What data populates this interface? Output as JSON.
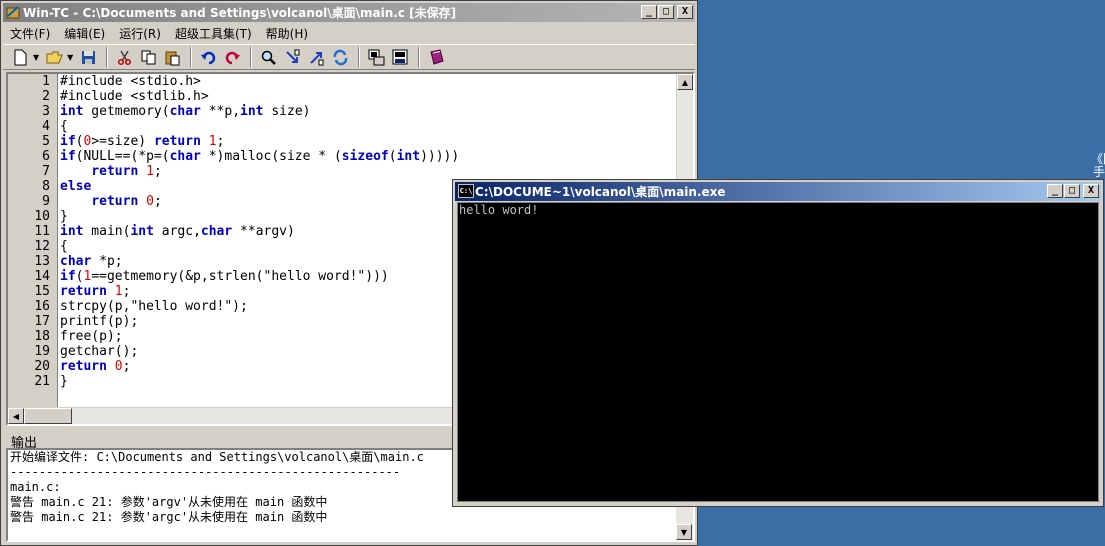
{
  "ide": {
    "title": "Win-TC - C:\\Documents and Settings\\volcanol\\桌面\\main.c [未保存]",
    "minimize": "_",
    "maximize": "□",
    "close": "X",
    "menu": [
      "文件(F)",
      "编辑(E)",
      "运行(R)",
      "超级工具集(T)",
      "帮助(H)"
    ]
  },
  "toolbar_icons": [
    "new-file-icon",
    "open-folder-icon",
    "save-icon",
    "cut-icon",
    "copy-icon",
    "paste-icon",
    "undo-icon",
    "redo-icon",
    "find-icon",
    "find-next-icon",
    "find-prev-icon",
    "replace-icon",
    "compile-icon",
    "run-icon",
    "help-book-icon"
  ],
  "editor": {
    "line_numbers": [
      "1",
      "2",
      "3",
      "4",
      "5",
      "6",
      "7",
      "8",
      "9",
      "10",
      "11",
      "12",
      "13",
      "14",
      "15",
      "16",
      "17",
      "18",
      "19",
      "20",
      "21"
    ],
    "lines": [
      [
        {
          "t": "txt",
          "s": "#include <stdio.h>"
        }
      ],
      [
        {
          "t": "txt",
          "s": "#include <stdlib.h>"
        }
      ],
      [
        {
          "t": "kw",
          "s": "int"
        },
        {
          "t": "txt",
          "s": " getmemory("
        },
        {
          "t": "kw",
          "s": "char"
        },
        {
          "t": "txt",
          "s": " **p,"
        },
        {
          "t": "kw",
          "s": "int"
        },
        {
          "t": "txt",
          "s": " size)"
        }
      ],
      [
        {
          "t": "txt",
          "s": "{"
        }
      ],
      [
        {
          "t": "kw",
          "s": "if"
        },
        {
          "t": "txt",
          "s": "("
        },
        {
          "t": "num",
          "s": "0"
        },
        {
          "t": "txt",
          "s": ">=size) "
        },
        {
          "t": "kw",
          "s": "return"
        },
        {
          "t": "txt",
          "s": " "
        },
        {
          "t": "num",
          "s": "1"
        },
        {
          "t": "txt",
          "s": ";"
        }
      ],
      [
        {
          "t": "kw",
          "s": "if"
        },
        {
          "t": "txt",
          "s": "(NULL==(*p=("
        },
        {
          "t": "kw",
          "s": "char"
        },
        {
          "t": "txt",
          "s": " *)malloc(size * ("
        },
        {
          "t": "kw",
          "s": "sizeof"
        },
        {
          "t": "txt",
          "s": "("
        },
        {
          "t": "kw",
          "s": "int"
        },
        {
          "t": "txt",
          "s": ")))))"
        }
      ],
      [
        {
          "t": "txt",
          "s": "    "
        },
        {
          "t": "kw",
          "s": "return"
        },
        {
          "t": "txt",
          "s": " "
        },
        {
          "t": "num",
          "s": "1"
        },
        {
          "t": "txt",
          "s": ";"
        }
      ],
      [
        {
          "t": "kw",
          "s": "else"
        }
      ],
      [
        {
          "t": "txt",
          "s": "    "
        },
        {
          "t": "kw",
          "s": "return"
        },
        {
          "t": "txt",
          "s": " "
        },
        {
          "t": "num",
          "s": "0"
        },
        {
          "t": "txt",
          "s": ";"
        }
      ],
      [
        {
          "t": "txt",
          "s": "}"
        }
      ],
      [
        {
          "t": "kw",
          "s": "int"
        },
        {
          "t": "txt",
          "s": " main("
        },
        {
          "t": "kw",
          "s": "int"
        },
        {
          "t": "txt",
          "s": " argc,"
        },
        {
          "t": "kw",
          "s": "char"
        },
        {
          "t": "txt",
          "s": " **argv)"
        }
      ],
      [
        {
          "t": "txt",
          "s": "{"
        }
      ],
      [
        {
          "t": "kw",
          "s": "char"
        },
        {
          "t": "txt",
          "s": " *p;"
        }
      ],
      [
        {
          "t": "kw",
          "s": "if"
        },
        {
          "t": "txt",
          "s": "("
        },
        {
          "t": "num",
          "s": "1"
        },
        {
          "t": "txt",
          "s": "==getmemory(&p,strlen(\"hello word!\")))"
        }
      ],
      [
        {
          "t": "kw",
          "s": "return"
        },
        {
          "t": "txt",
          "s": " "
        },
        {
          "t": "num",
          "s": "1"
        },
        {
          "t": "txt",
          "s": ";"
        }
      ],
      [
        {
          "t": "txt",
          "s": "strcpy(p,\"hello word!\");"
        }
      ],
      [
        {
          "t": "txt",
          "s": "printf(p);"
        }
      ],
      [
        {
          "t": "txt",
          "s": "free(p);"
        }
      ],
      [
        {
          "t": "txt",
          "s": "getchar();"
        }
      ],
      [
        {
          "t": "kw",
          "s": "return"
        },
        {
          "t": "txt",
          "s": " "
        },
        {
          "t": "num",
          "s": "0"
        },
        {
          "t": "txt",
          "s": ";"
        }
      ],
      [
        {
          "t": "txt",
          "s": "}"
        }
      ]
    ]
  },
  "output": {
    "label": "输出",
    "lines": [
      "开始编译文件: C:\\Documents and Settings\\volcanol\\桌面\\main.c",
      "------------------------------------------------------",
      "main.c:",
      "警告 main.c 21: 参数'argv'从未使用在 main 函数中",
      "警告 main.c 21: 参数'argc'从未使用在 main 函数中"
    ]
  },
  "console": {
    "title": "C:\\DOCUME~1\\volcanol\\桌面\\main.exe",
    "icon_text": "C:\\",
    "minimize": "_",
    "maximize": "□",
    "close": "X",
    "lines": [
      "hello word!"
    ]
  },
  "desktop": {
    "fragment1": "《图",
    "fragment2": "手"
  },
  "colors": {
    "keyword": "#0000c0",
    "number": "#e00000",
    "desktop": "#3a6ea5",
    "console_title": "#0a246a"
  }
}
